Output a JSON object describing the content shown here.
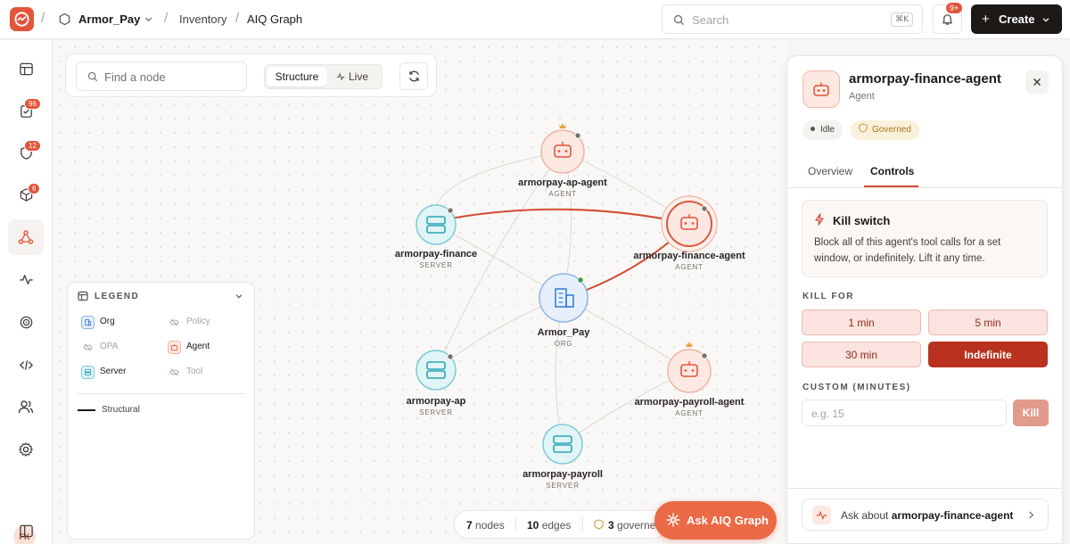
{
  "colors": {
    "accent": "#e2553b",
    "agent": "#e2553b",
    "server": "#2aa6b5",
    "org": "#3b7fd6",
    "danger": "#b8321f"
  },
  "breadcrumb": {
    "workspace": "Armor_Pay",
    "section": "Inventory",
    "page": "AIQ Graph"
  },
  "header": {
    "search_placeholder": "Search",
    "search_shortcut": "⌘K",
    "notif_badge": "9+",
    "create_label": "Create"
  },
  "sidebar": {
    "badges": {
      "tasks": "96",
      "shield": "12",
      "packages": "6"
    },
    "user_initials": "FK"
  },
  "toolbar": {
    "find_placeholder": "Find a node",
    "mode_structure": "Structure",
    "mode_live": "Live"
  },
  "legend": {
    "title": "LEGEND",
    "items": {
      "org": "Org",
      "policy": "Policy",
      "opa": "OPA",
      "agent": "Agent",
      "server": "Server",
      "tool": "Tool"
    },
    "edge_structural": "Structural"
  },
  "graph": {
    "nodes": {
      "ap_agent": {
        "name": "armorpay-ap-agent",
        "type": "AGENT"
      },
      "finance": {
        "name": "armorpay-finance",
        "type": "SERVER"
      },
      "finance_agent": {
        "name": "armorpay-finance-agent",
        "type": "AGENT"
      },
      "org": {
        "name": "Armor_Pay",
        "type": "ORG"
      },
      "ap": {
        "name": "armorpay-ap",
        "type": "SERVER"
      },
      "payroll_agent": {
        "name": "armorpay-payroll-agent",
        "type": "AGENT"
      },
      "payroll": {
        "name": "armorpay-payroll",
        "type": "SERVER"
      }
    }
  },
  "status": {
    "nodes_count": "7",
    "nodes_label": "nodes",
    "edges_count": "10",
    "edges_label": "edges",
    "governed_count": "3",
    "governed_label": "governed"
  },
  "ask_graph_label": "Ask AIQ Graph",
  "panel": {
    "title": "armorpay-finance-agent",
    "subtitle": "Agent",
    "status_idle": "Idle",
    "status_governed": "Governed",
    "tab_overview": "Overview",
    "tab_controls": "Controls",
    "kill_switch_title": "Kill switch",
    "kill_switch_desc": "Block all of this agent's tool calls for a set window, or indefinitely. Lift it any time.",
    "kill_for_label": "KILL FOR",
    "durations": {
      "d1": "1 min",
      "d2": "5 min",
      "d3": "30 min",
      "d4": "Indefinite"
    },
    "custom_label": "CUSTOM (MINUTES)",
    "custom_placeholder": "e.g. 15",
    "kill_button": "Kill",
    "ask_prefix": "Ask about",
    "ask_target": "armorpay-finance-agent"
  }
}
